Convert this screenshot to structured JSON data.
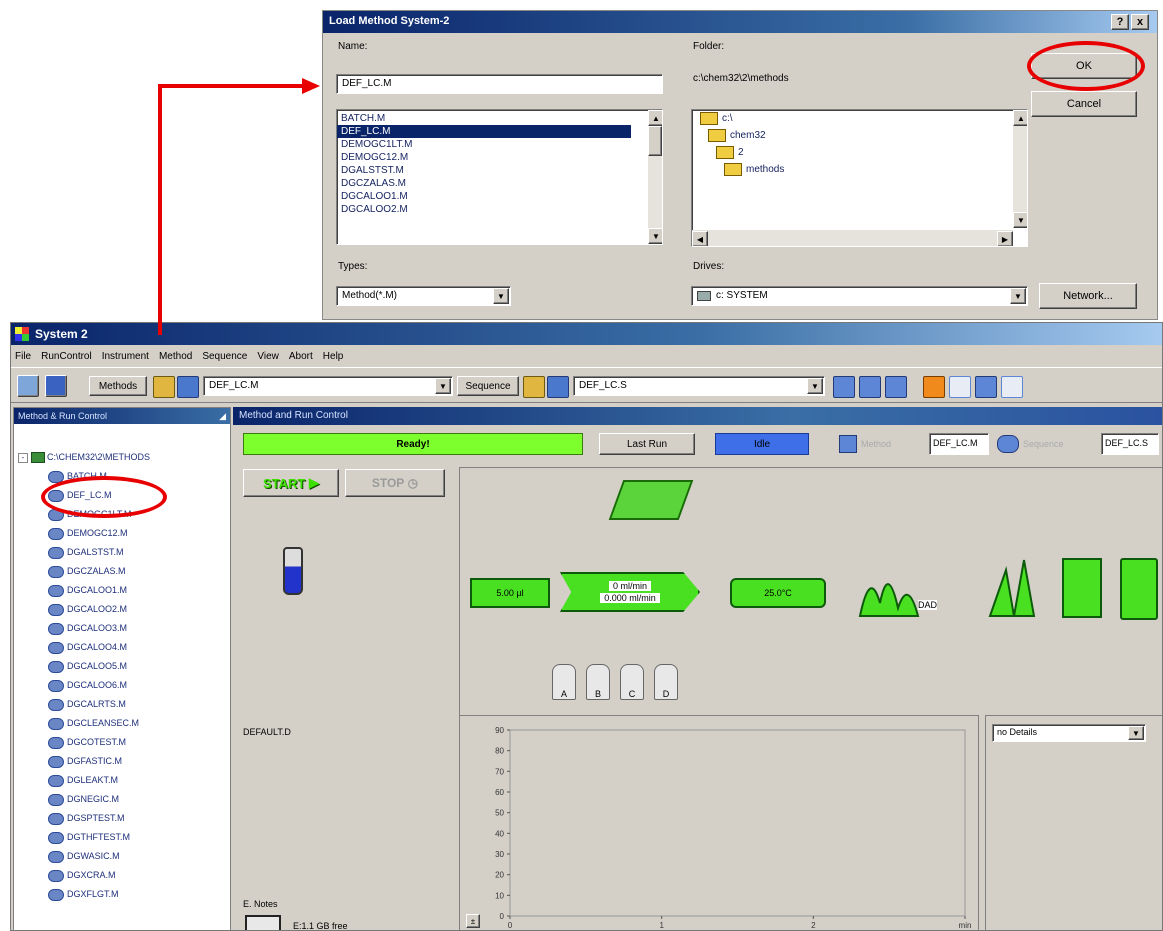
{
  "dialog": {
    "title": "Load Method System-2",
    "help_btn": "?",
    "close_btn": "x",
    "name_label": "Name:",
    "name_value": "DEF_LC.M",
    "files": [
      "BATCH.M",
      "DEF_LC.M",
      "DEMOGC1LT.M",
      "DEMOGC12.M",
      "DGALSTST.M",
      "DGCZALAS.M",
      "DGCALOO1.M",
      "DGCALOO2.M"
    ],
    "selected_file_index": 1,
    "folder_label": "Folder:",
    "folder_path": "c:\\chem32\\2\\methods",
    "folders": [
      "c:\\",
      "chem32",
      "2",
      "methods"
    ],
    "types_label": "Types:",
    "types_value": "Method(*.M)",
    "drives_label": "Drives:",
    "drives_value": "c: SYSTEM",
    "ok_label": "OK",
    "cancel_label": "Cancel",
    "network_label": "Network..."
  },
  "app": {
    "title": "System 2",
    "menu": [
      "File",
      "RunControl",
      "Instrument",
      "Method",
      "Sequence",
      "View",
      "Abort",
      "Help"
    ],
    "toolbar": {
      "methods_label": "Methods",
      "method_value": "DEF_LC.M",
      "sequence_label": "Sequence",
      "sequence_value": "DEF_LC.S"
    },
    "sidebar": {
      "header": "Method & Run Control",
      "root": "C:\\CHEM32\\2\\METHODS",
      "items": [
        "BATCH.M",
        "DEF_LC.M",
        "DEMOGC1LT.M",
        "DEMOGC12.M",
        "DGALSTST.M",
        "DGCZALAS.M",
        "DGCALOO1.M",
        "DGCALOO2.M",
        "DGCALOO3.M",
        "DGCALOO4.M",
        "DGCALOO5.M",
        "DGCALOO6.M",
        "DGCALRTS.M",
        "DGCLEANSEC.M",
        "DGCOTEST.M",
        "DGFASTIC.M",
        "DGLEAKT.M",
        "DGNEGIC.M",
        "DGSPTEST.M",
        "DGTHFTEST.M",
        "DGWASIC.M",
        "DGXCRA.M",
        "DGXFLGT.M"
      ]
    },
    "panel": {
      "title": "Method and Run Control",
      "status": "Ready!",
      "last_run_label": "Last Run",
      "run_status": "Idle",
      "method_label": "Method",
      "method_value": "DEF_LC.M",
      "sequence_label": "Sequence",
      "sequence_value": "DEF_LC.S",
      "start_label": "START",
      "stop_label": "STOP",
      "default_label": "DEFAULT.D",
      "injector_volume": "5.00 µl",
      "pump_flow": "0 ml/min",
      "pump_time": "0.000 ml/min",
      "column_temp": "25.0°C",
      "detector_label": "DAD",
      "bottles": [
        "A",
        "B",
        "C",
        "D"
      ],
      "notes_label": "E. Notes",
      "notes_value": "E:1.1 GB free",
      "details_select": "no Details",
      "chart": {
        "y_ticks": [
          "90",
          "80",
          "70",
          "60",
          "50",
          "40",
          "30",
          "20",
          "10",
          "0"
        ],
        "x_ticks": [
          "0",
          "1",
          "2",
          "min"
        ]
      }
    }
  },
  "chart_data": {
    "type": "line",
    "title": "",
    "xlabel": "min",
    "ylabel": "",
    "ylim": [
      0,
      90
    ],
    "xlim": [
      0,
      3
    ],
    "series": []
  },
  "colors": {
    "status_green": "#7cff2c",
    "idle_blue": "#3e6ee8",
    "highlight_red": "#e80000",
    "title_blue": "#0a246a",
    "window_gray": "#d4d0c8"
  }
}
